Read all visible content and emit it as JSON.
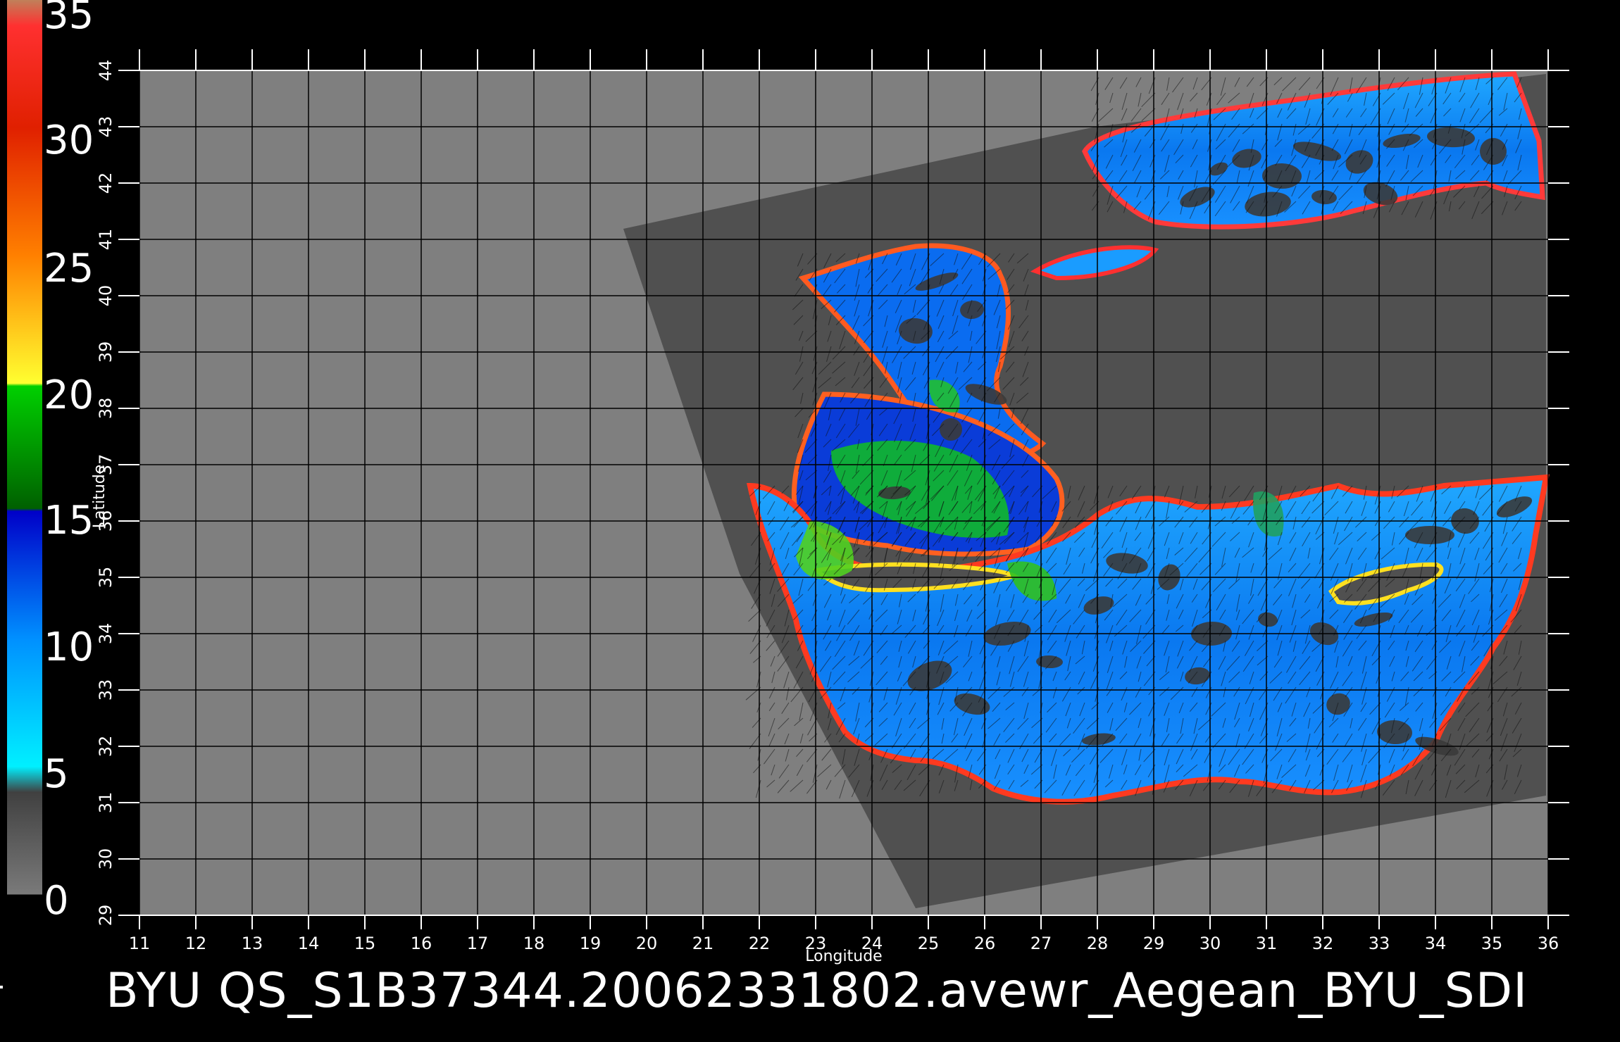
{
  "caption": "BYU  QS_S1B37344.20062331802.avewr_Aegean_BYU_SDI",
  "map": {
    "x_axis_label": "Longitude",
    "y_axis_label": "Latitude",
    "lon_range": [
      11,
      36
    ],
    "lat_range": [
      29,
      44
    ],
    "x_ticks": [
      "11",
      "12",
      "13",
      "14",
      "15",
      "16",
      "17",
      "18",
      "19",
      "20",
      "21",
      "22",
      "23",
      "24",
      "25",
      "26",
      "27",
      "28",
      "29",
      "30",
      "31",
      "32",
      "33",
      "34",
      "35",
      "36"
    ],
    "y_ticks": [
      "29",
      "30",
      "31",
      "32",
      "33",
      "34",
      "35",
      "36",
      "37",
      "38",
      "39",
      "40",
      "41",
      "42",
      "43",
      "44"
    ],
    "land_color": "#7f7f7f",
    "swath_color": "#505050"
  },
  "colorbar": {
    "labels": [
      "35",
      "30",
      "25",
      "20",
      "15",
      "10",
      "5",
      "0"
    ],
    "stops": [
      {
        "value": 0,
        "color": "#7a7a7a"
      },
      {
        "value": 4,
        "color": "#404040"
      },
      {
        "value": 5,
        "color": "#00f0ff"
      },
      {
        "value": 10,
        "color": "#0090ff"
      },
      {
        "value": 15,
        "color": "#0000c8"
      },
      {
        "value": 15.1,
        "color": "#006000"
      },
      {
        "value": 19.9,
        "color": "#00d000"
      },
      {
        "value": 20,
        "color": "#ffff30"
      },
      {
        "value": 25,
        "color": "#ff8000"
      },
      {
        "value": 30,
        "color": "#e02000"
      },
      {
        "value": 34,
        "color": "#ff3030"
      },
      {
        "value": 35,
        "color": "#c0805a"
      }
    ]
  }
}
